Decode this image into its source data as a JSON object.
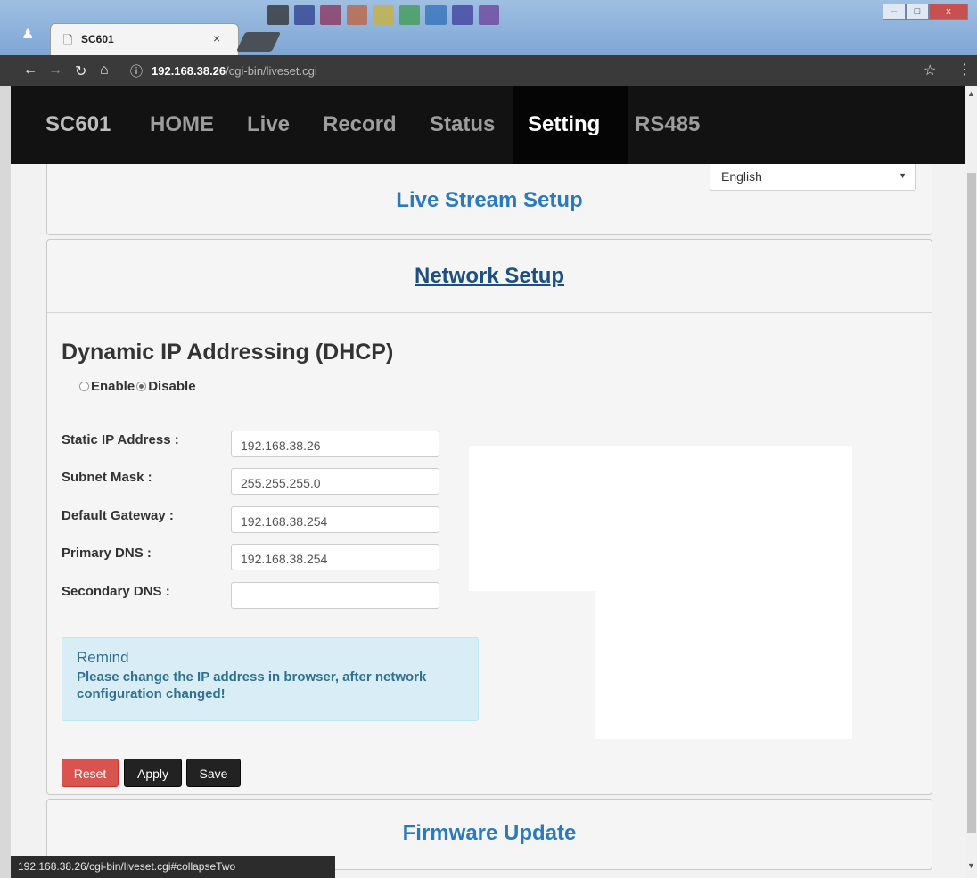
{
  "browser": {
    "tab_title": "SC601",
    "tab_close": "×",
    "url_host": "192.168.38.26",
    "url_path": "/cgi-bin/liveset.cgi",
    "status_url": "192.168.38.26/cgi-bin/liveset.cgi#collapseTwo",
    "window_controls": [
      "–",
      "□",
      "x"
    ]
  },
  "navbar": {
    "brand": "SC601",
    "items": [
      "HOME",
      "Live",
      "Record",
      "Status",
      "Setting",
      "RS485"
    ],
    "active": "Setting"
  },
  "language": {
    "selected": "English"
  },
  "panels": {
    "live_stream": "Live Stream Setup",
    "network": "Network Setup",
    "firmware": "Firmware Update"
  },
  "dhcp": {
    "heading": "Dynamic IP Addressing (DHCP)",
    "enable_label": "Enable",
    "disable_label": "Disable",
    "selected": "Disable"
  },
  "fields": [
    {
      "label": "Static IP Address :",
      "value": "192.168.38.26"
    },
    {
      "label": "Subnet Mask :",
      "value": "255.255.255.0"
    },
    {
      "label": "Default Gateway :",
      "value": "192.168.38.254"
    },
    {
      "label": "Primary DNS :",
      "value": "192.168.38.254"
    },
    {
      "label": "Secondary DNS :",
      "value": ""
    }
  ],
  "remind": {
    "title": "Remind",
    "body": "Please change the IP address in browser, after network configuration changed!"
  },
  "buttons": {
    "reset": "Reset",
    "apply": "Apply",
    "save": "Save"
  },
  "colors": {
    "panel_title": "#2a7abf",
    "reset_button": "#d9534f",
    "navbar_bg": "#121212",
    "remind_bg": "#d9edf7"
  }
}
